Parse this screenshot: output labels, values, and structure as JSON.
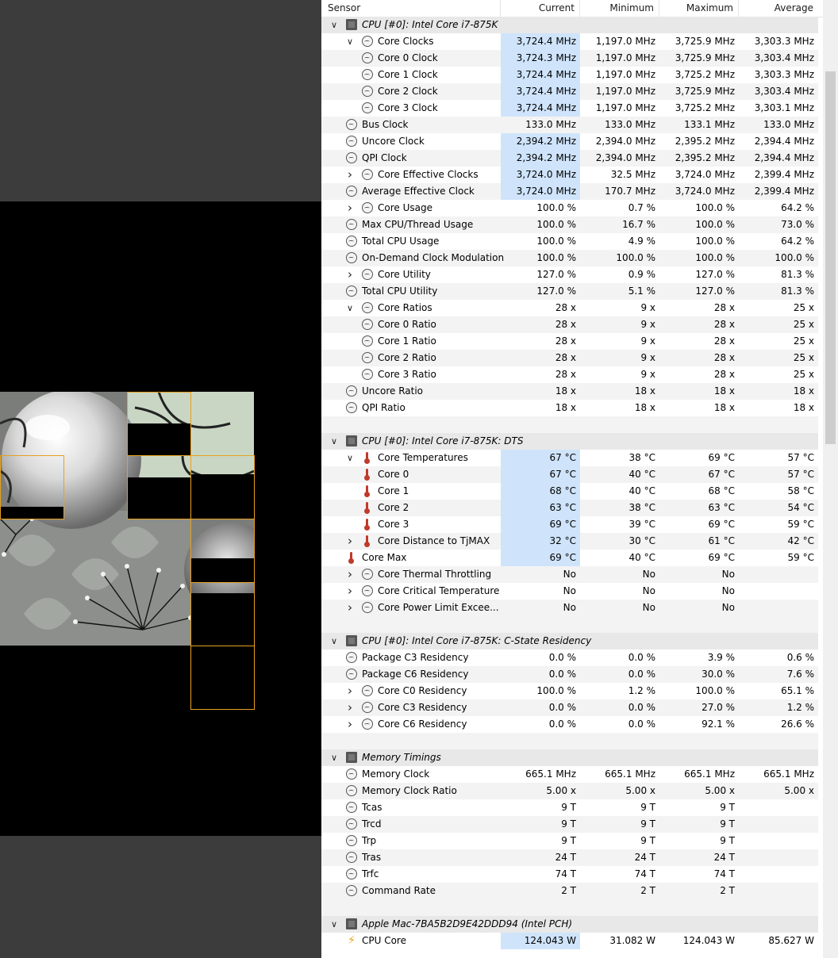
{
  "columns": {
    "sensor": "Sensor",
    "current": "Current",
    "minimum": "Minimum",
    "maximum": "Maximum",
    "average": "Average"
  },
  "icons": {
    "clock": "clock-icon",
    "temperature": "thermometer-icon",
    "chip": "chip-icon",
    "power": "lightning-icon"
  },
  "colors": {
    "highlight": "#cfe4fb",
    "frame": "#e6a020",
    "group_bg": "#e8e8e8"
  },
  "groups": [
    {
      "title": "CPU [#0]: Intel Core i7-875K",
      "rows": [
        {
          "label": "Core Clocks",
          "indent": 2,
          "exp": "down",
          "icon": "clock",
          "cur": "3,724.4 MHz",
          "min": "1,197.0 MHz",
          "max": "3,725.9 MHz",
          "avg": "3,303.3 MHz",
          "hl": true
        },
        {
          "label": "Core 0 Clock",
          "indent": 3,
          "exp": "",
          "icon": "clock",
          "cur": "3,724.3 MHz",
          "min": "1,197.0 MHz",
          "max": "3,725.9 MHz",
          "avg": "3,303.4 MHz",
          "hl": true
        },
        {
          "label": "Core 1 Clock",
          "indent": 3,
          "exp": "",
          "icon": "clock",
          "cur": "3,724.4 MHz",
          "min": "1,197.0 MHz",
          "max": "3,725.2 MHz",
          "avg": "3,303.3 MHz",
          "hl": true
        },
        {
          "label": "Core 2 Clock",
          "indent": 3,
          "exp": "",
          "icon": "clock",
          "cur": "3,724.4 MHz",
          "min": "1,197.0 MHz",
          "max": "3,725.9 MHz",
          "avg": "3,303.4 MHz",
          "hl": true
        },
        {
          "label": "Core 3 Clock",
          "indent": 3,
          "exp": "",
          "icon": "clock",
          "cur": "3,724.4 MHz",
          "min": "1,197.0 MHz",
          "max": "3,725.2 MHz",
          "avg": "3,303.1 MHz",
          "hl": true
        },
        {
          "label": "Bus Clock",
          "indent": 1,
          "exp": "",
          "icon": "clock",
          "cur": "133.0 MHz",
          "min": "133.0 MHz",
          "max": "133.1 MHz",
          "avg": "133.0 MHz",
          "hl": false
        },
        {
          "label": "Uncore Clock",
          "indent": 1,
          "exp": "",
          "icon": "clock",
          "cur": "2,394.2 MHz",
          "min": "2,394.0 MHz",
          "max": "2,395.2 MHz",
          "avg": "2,394.4 MHz",
          "hl": true
        },
        {
          "label": "QPI Clock",
          "indent": 1,
          "exp": "",
          "icon": "clock",
          "cur": "2,394.2 MHz",
          "min": "2,394.0 MHz",
          "max": "2,395.2 MHz",
          "avg": "2,394.4 MHz",
          "hl": true
        },
        {
          "label": "Core Effective Clocks",
          "indent": 2,
          "exp": "right",
          "icon": "clock",
          "cur": "3,724.0 MHz",
          "min": "32.5 MHz",
          "max": "3,724.0 MHz",
          "avg": "2,399.4 MHz",
          "hl": true
        },
        {
          "label": "Average Effective Clock",
          "indent": 1,
          "exp": "",
          "icon": "clock",
          "cur": "3,724.0 MHz",
          "min": "170.7 MHz",
          "max": "3,724.0 MHz",
          "avg": "2,399.4 MHz",
          "hl": true
        },
        {
          "label": "Core Usage",
          "indent": 2,
          "exp": "right",
          "icon": "clock",
          "cur": "100.0 %",
          "min": "0.7 %",
          "max": "100.0 %",
          "avg": "64.2 %",
          "hl": false
        },
        {
          "label": "Max CPU/Thread Usage",
          "indent": 1,
          "exp": "",
          "icon": "clock",
          "cur": "100.0 %",
          "min": "16.7 %",
          "max": "100.0 %",
          "avg": "73.0 %",
          "hl": false
        },
        {
          "label": "Total CPU Usage",
          "indent": 1,
          "exp": "",
          "icon": "clock",
          "cur": "100.0 %",
          "min": "4.9 %",
          "max": "100.0 %",
          "avg": "64.2 %",
          "hl": false
        },
        {
          "label": "On-Demand Clock Modulation",
          "indent": 1,
          "exp": "",
          "icon": "clock",
          "cur": "100.0 %",
          "min": "100.0 %",
          "max": "100.0 %",
          "avg": "100.0 %",
          "hl": false
        },
        {
          "label": "Core Utility",
          "indent": 2,
          "exp": "right",
          "icon": "clock",
          "cur": "127.0 %",
          "min": "0.9 %",
          "max": "127.0 %",
          "avg": "81.3 %",
          "hl": false
        },
        {
          "label": "Total CPU Utility",
          "indent": 1,
          "exp": "",
          "icon": "clock",
          "cur": "127.0 %",
          "min": "5.1 %",
          "max": "127.0 %",
          "avg": "81.3 %",
          "hl": false
        },
        {
          "label": "Core Ratios",
          "indent": 2,
          "exp": "down",
          "icon": "clock",
          "cur": "28 x",
          "min": "9 x",
          "max": "28 x",
          "avg": "25 x",
          "hl": false
        },
        {
          "label": "Core 0 Ratio",
          "indent": 3,
          "exp": "",
          "icon": "clock",
          "cur": "28 x",
          "min": "9 x",
          "max": "28 x",
          "avg": "25 x",
          "hl": false
        },
        {
          "label": "Core 1 Ratio",
          "indent": 3,
          "exp": "",
          "icon": "clock",
          "cur": "28 x",
          "min": "9 x",
          "max": "28 x",
          "avg": "25 x",
          "hl": false
        },
        {
          "label": "Core 2 Ratio",
          "indent": 3,
          "exp": "",
          "icon": "clock",
          "cur": "28 x",
          "min": "9 x",
          "max": "28 x",
          "avg": "25 x",
          "hl": false
        },
        {
          "label": "Core 3 Ratio",
          "indent": 3,
          "exp": "",
          "icon": "clock",
          "cur": "28 x",
          "min": "9 x",
          "max": "28 x",
          "avg": "25 x",
          "hl": false
        },
        {
          "label": "Uncore Ratio",
          "indent": 1,
          "exp": "",
          "icon": "clock",
          "cur": "18 x",
          "min": "18 x",
          "max": "18 x",
          "avg": "18 x",
          "hl": false
        },
        {
          "label": "QPI Ratio",
          "indent": 1,
          "exp": "",
          "icon": "clock",
          "cur": "18 x",
          "min": "18 x",
          "max": "18 x",
          "avg": "18 x",
          "hl": false
        }
      ]
    },
    {
      "title": "CPU [#0]: Intel Core i7-875K: DTS",
      "rows": [
        {
          "label": "Core Temperatures",
          "indent": 2,
          "exp": "down",
          "icon": "temperature",
          "cur": "67 °C",
          "min": "38 °C",
          "max": "69 °C",
          "avg": "57 °C",
          "hl": true
        },
        {
          "label": "Core 0",
          "indent": 2,
          "exp": "",
          "icon": "temperature",
          "cur": "67 °C",
          "min": "40 °C",
          "max": "67 °C",
          "avg": "57 °C",
          "hl": true
        },
        {
          "label": "Core 1",
          "indent": 2,
          "exp": "",
          "icon": "temperature",
          "cur": "68 °C",
          "min": "40 °C",
          "max": "68 °C",
          "avg": "58 °C",
          "hl": true
        },
        {
          "label": "Core 2",
          "indent": 2,
          "exp": "",
          "icon": "temperature",
          "cur": "63 °C",
          "min": "38 °C",
          "max": "63 °C",
          "avg": "54 °C",
          "hl": true
        },
        {
          "label": "Core 3",
          "indent": 2,
          "exp": "",
          "icon": "temperature",
          "cur": "69 °C",
          "min": "39 °C",
          "max": "69 °C",
          "avg": "59 °C",
          "hl": true
        },
        {
          "label": "Core Distance to TjMAX",
          "indent": 2,
          "exp": "right",
          "icon": "temperature",
          "cur": "32 °C",
          "min": "30 °C",
          "max": "61 °C",
          "avg": "42 °C",
          "hl": true
        },
        {
          "label": "Core Max",
          "indent": 1,
          "exp": "",
          "icon": "temperature",
          "cur": "69 °C",
          "min": "40 °C",
          "max": "69 °C",
          "avg": "59 °C",
          "hl": true
        },
        {
          "label": "Core Thermal Throttling",
          "indent": 2,
          "exp": "right",
          "icon": "clock",
          "cur": "No",
          "min": "No",
          "max": "No",
          "avg": "",
          "hl": false
        },
        {
          "label": "Core Critical Temperature",
          "indent": 2,
          "exp": "right",
          "icon": "clock",
          "cur": "No",
          "min": "No",
          "max": "No",
          "avg": "",
          "hl": false
        },
        {
          "label": "Core Power Limit Excee...",
          "indent": 2,
          "exp": "right",
          "icon": "clock",
          "cur": "No",
          "min": "No",
          "max": "No",
          "avg": "",
          "hl": false
        }
      ]
    },
    {
      "title": "CPU [#0]: Intel Core i7-875K: C-State Residency",
      "rows": [
        {
          "label": "Package C3 Residency",
          "indent": 1,
          "exp": "",
          "icon": "clock",
          "cur": "0.0 %",
          "min": "0.0 %",
          "max": "3.9 %",
          "avg": "0.6 %",
          "hl": false
        },
        {
          "label": "Package C6 Residency",
          "indent": 1,
          "exp": "",
          "icon": "clock",
          "cur": "0.0 %",
          "min": "0.0 %",
          "max": "30.0 %",
          "avg": "7.6 %",
          "hl": false
        },
        {
          "label": "Core C0 Residency",
          "indent": 2,
          "exp": "right",
          "icon": "clock",
          "cur": "100.0 %",
          "min": "1.2 %",
          "max": "100.0 %",
          "avg": "65.1 %",
          "hl": false
        },
        {
          "label": "Core C3 Residency",
          "indent": 2,
          "exp": "right",
          "icon": "clock",
          "cur": "0.0 %",
          "min": "0.0 %",
          "max": "27.0 %",
          "avg": "1.2 %",
          "hl": false
        },
        {
          "label": "Core C6 Residency",
          "indent": 2,
          "exp": "right",
          "icon": "clock",
          "cur": "0.0 %",
          "min": "0.0 %",
          "max": "92.1 %",
          "avg": "26.6 %",
          "hl": false
        }
      ]
    },
    {
      "title": "Memory Timings",
      "rows": [
        {
          "label": "Memory Clock",
          "indent": 1,
          "exp": "",
          "icon": "clock",
          "cur": "665.1 MHz",
          "min": "665.1 MHz",
          "max": "665.1 MHz",
          "avg": "665.1 MHz",
          "hl": false
        },
        {
          "label": "Memory Clock Ratio",
          "indent": 1,
          "exp": "",
          "icon": "clock",
          "cur": "5.00 x",
          "min": "5.00 x",
          "max": "5.00 x",
          "avg": "5.00 x",
          "hl": false
        },
        {
          "label": "Tcas",
          "indent": 1,
          "exp": "",
          "icon": "clock",
          "cur": "9 T",
          "min": "9 T",
          "max": "9 T",
          "avg": "",
          "hl": false
        },
        {
          "label": "Trcd",
          "indent": 1,
          "exp": "",
          "icon": "clock",
          "cur": "9 T",
          "min": "9 T",
          "max": "9 T",
          "avg": "",
          "hl": false
        },
        {
          "label": "Trp",
          "indent": 1,
          "exp": "",
          "icon": "clock",
          "cur": "9 T",
          "min": "9 T",
          "max": "9 T",
          "avg": "",
          "hl": false
        },
        {
          "label": "Tras",
          "indent": 1,
          "exp": "",
          "icon": "clock",
          "cur": "24 T",
          "min": "24 T",
          "max": "24 T",
          "avg": "",
          "hl": false
        },
        {
          "label": "Trfc",
          "indent": 1,
          "exp": "",
          "icon": "clock",
          "cur": "74 T",
          "min": "74 T",
          "max": "74 T",
          "avg": "",
          "hl": false
        },
        {
          "label": "Command Rate",
          "indent": 1,
          "exp": "",
          "icon": "clock",
          "cur": "2 T",
          "min": "2 T",
          "max": "2 T",
          "avg": "",
          "hl": false
        }
      ]
    },
    {
      "title": "Apple Mac-7BA5B2D9E42DDD94 (Intel PCH)",
      "rows": [
        {
          "label": "CPU Core",
          "indent": 1,
          "exp": "",
          "icon": "power",
          "cur": "124.043 W",
          "min": "31.082 W",
          "max": "124.043 W",
          "avg": "85.627 W",
          "hl": true
        }
      ]
    }
  ]
}
